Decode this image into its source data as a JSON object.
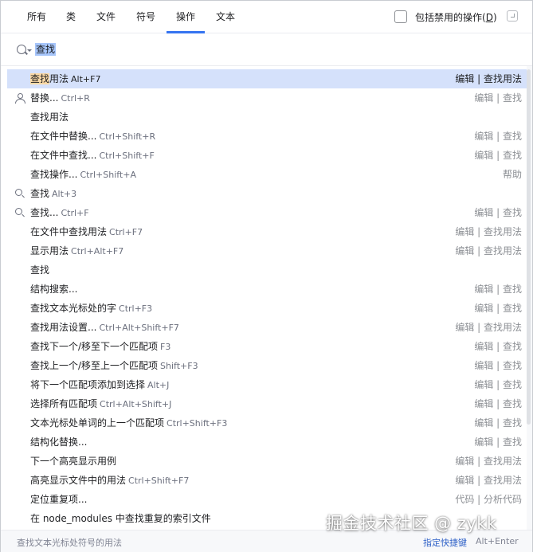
{
  "tabs": [
    {
      "label": "所有"
    },
    {
      "label": "类"
    },
    {
      "label": "文件"
    },
    {
      "label": "符号"
    },
    {
      "label": "操作"
    },
    {
      "label": "文本"
    }
  ],
  "active_tab": "操作",
  "include_disabled": {
    "label": "包括禁用的操作(",
    "mnemonic": "D",
    "suffix": ")",
    "checked": false
  },
  "search": {
    "value": "查找"
  },
  "results": [
    {
      "pre": "",
      "hl": "查找",
      "rest": "用法",
      "shortcut": "Alt+F7",
      "location": "编辑 | 查找用法",
      "icon": "none",
      "selected": true
    },
    {
      "pre": "替换...",
      "hl": "",
      "rest": "",
      "shortcut": "Ctrl+R",
      "location": "编辑 | 查找",
      "icon": "person-icon",
      "selected": false
    },
    {
      "pre": "",
      "hl": "",
      "rest": "查找用法",
      "shortcut": "",
      "location": "",
      "icon": "none",
      "selected": false
    },
    {
      "pre": "",
      "hl": "",
      "rest": "在文件中替换...",
      "shortcut": "Ctrl+Shift+R",
      "location": "编辑 | 查找",
      "icon": "none",
      "selected": false
    },
    {
      "pre": "",
      "hl": "",
      "rest": "在文件中查找...",
      "shortcut": "Ctrl+Shift+F",
      "location": "编辑 | 查找",
      "icon": "none",
      "selected": false
    },
    {
      "pre": "",
      "hl": "",
      "rest": "查找操作...",
      "shortcut": "Ctrl+Shift+A",
      "location": "帮助",
      "icon": "none",
      "selected": false
    },
    {
      "pre": "",
      "hl": "",
      "rest": "查找",
      "shortcut": "Alt+3",
      "location": "",
      "icon": "search-icon",
      "selected": false
    },
    {
      "pre": "",
      "hl": "",
      "rest": "查找...",
      "shortcut": "Ctrl+F",
      "location": "编辑 | 查找",
      "icon": "search-icon",
      "selected": false
    },
    {
      "pre": "",
      "hl": "",
      "rest": "在文件中查找用法",
      "shortcut": "Ctrl+F7",
      "location": "编辑 | 查找用法",
      "icon": "none",
      "selected": false
    },
    {
      "pre": "",
      "hl": "",
      "rest": "显示用法",
      "shortcut": "Ctrl+Alt+F7",
      "location": "编辑 | 查找用法",
      "icon": "none",
      "selected": false
    },
    {
      "pre": "",
      "hl": "",
      "rest": "查找",
      "shortcut": "",
      "location": "",
      "icon": "none",
      "selected": false
    },
    {
      "pre": "",
      "hl": "",
      "rest": "结构搜索...",
      "shortcut": "",
      "location": "编辑 | 查找",
      "icon": "none",
      "selected": false
    },
    {
      "pre": "",
      "hl": "",
      "rest": "查找文本光标处的字",
      "shortcut": "Ctrl+F3",
      "location": "编辑 | 查找",
      "icon": "none",
      "selected": false
    },
    {
      "pre": "",
      "hl": "",
      "rest": "查找用法设置...",
      "shortcut": "Ctrl+Alt+Shift+F7",
      "location": "编辑 | 查找用法",
      "icon": "none",
      "selected": false
    },
    {
      "pre": "",
      "hl": "",
      "rest": "查找下一个/移至下一个匹配项",
      "shortcut": "F3",
      "location": "编辑 | 查找",
      "icon": "none",
      "selected": false
    },
    {
      "pre": "",
      "hl": "",
      "rest": "查找上一个/移至上一个匹配项",
      "shortcut": "Shift+F3",
      "location": "编辑 | 查找",
      "icon": "none",
      "selected": false
    },
    {
      "pre": "",
      "hl": "",
      "rest": "将下一个匹配项添加到选择",
      "shortcut": "Alt+J",
      "location": "编辑 | 查找",
      "icon": "none",
      "selected": false
    },
    {
      "pre": "",
      "hl": "",
      "rest": "选择所有匹配项",
      "shortcut": "Ctrl+Alt+Shift+J",
      "location": "编辑 | 查找",
      "icon": "none",
      "selected": false
    },
    {
      "pre": "",
      "hl": "",
      "rest": "文本光标处单词的上一个匹配项",
      "shortcut": "Ctrl+Shift+F3",
      "location": "编辑 | 查找",
      "icon": "none",
      "selected": false
    },
    {
      "pre": "",
      "hl": "",
      "rest": "结构化替换...",
      "shortcut": "",
      "location": "编辑 | 查找",
      "icon": "none",
      "selected": false
    },
    {
      "pre": "",
      "hl": "",
      "rest": "下一个高亮显示用例",
      "shortcut": "",
      "location": "编辑 | 查找用法",
      "icon": "none",
      "selected": false
    },
    {
      "pre": "",
      "hl": "",
      "rest": "高亮显示文件中的用法",
      "shortcut": "Ctrl+Shift+F7",
      "location": "编辑 | 查找用法",
      "icon": "none",
      "selected": false
    },
    {
      "pre": "",
      "hl": "",
      "rest": "定位重复项...",
      "shortcut": "",
      "location": "代码 | 分析代码",
      "icon": "none",
      "selected": false
    },
    {
      "pre": "",
      "hl": "",
      "rest": "在 node_modules 中查找重复的索引文件",
      "shortcut": "",
      "location": "",
      "icon": "none",
      "selected": false
    }
  ],
  "footer": {
    "hint": "查找文本光标处符号的用法",
    "assign_label": "指定快捷键",
    "assign_shortcut": "Alt+Enter"
  },
  "watermark": "掘金技术社区 @ zykk",
  "colors": {
    "accent": "#3574f0",
    "selection": "#d5e1fb",
    "match_highlight": "#fbd9a6"
  }
}
